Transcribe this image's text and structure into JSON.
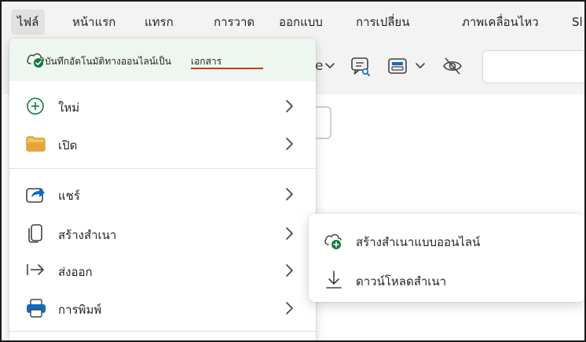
{
  "ribbon": {
    "tabs": [
      {
        "label": "ไฟล์",
        "active": true
      },
      {
        "label": "หน้าแรก"
      },
      {
        "label": "แทรก"
      },
      {
        "label": "การวาด"
      },
      {
        "label": "ออกแบบ"
      },
      {
        "label": "การเปลี่ยน"
      },
      {
        "label": "ภาพเคลื่อนไหว"
      },
      {
        "label": "Sl"
      }
    ],
    "toolbar_partial_label": "e"
  },
  "file_menu": {
    "autosave_text": "บันทึกอัตโนมัติทางออนไลน์เป็น",
    "autosave_location": "เอกสาร",
    "items": [
      {
        "label": "ใหม่",
        "icon": "new-plus-icon"
      },
      {
        "label": "เปิด",
        "icon": "folder-icon"
      },
      {
        "label": "แชร์",
        "icon": "share-icon"
      },
      {
        "label": "สร้างสำเนา",
        "icon": "copy-icon"
      },
      {
        "label": "ส่งออก",
        "icon": "export-icon"
      },
      {
        "label": "การพิมพ์",
        "icon": "printer-icon"
      }
    ]
  },
  "submenu": {
    "items": [
      {
        "label": "สร้างสำเนาแบบออนไลน์",
        "icon": "cloud-add-icon"
      },
      {
        "label": "ดาวน์โหลดสำเนา",
        "icon": "download-icon"
      }
    ]
  },
  "colors": {
    "accent_green": "#107c41",
    "underline_red": "#c43e1c",
    "folder_orange": "#e8a33d",
    "share_blue": "#0f6cbd",
    "header_bg": "#eef6f0"
  }
}
